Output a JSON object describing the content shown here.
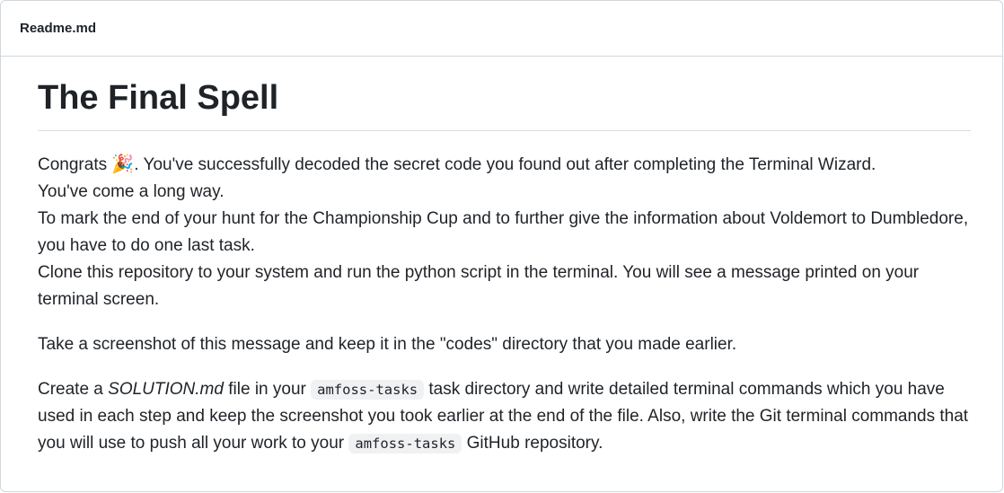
{
  "readme": {
    "filename": "Readme.md"
  },
  "content": {
    "title": "The Final Spell",
    "intro": {
      "congrats_word": "Congrats",
      "party_emoji": "🎉",
      "line1_rest": ". You've successfully decoded the secret code you found out after completing the Terminal Wizard.",
      "line2": "You've come a long way.",
      "line3": "To mark the end of your hunt for the Championship Cup and to further give the information about Voldemort to Dumbledore, you have to do one last task.",
      "line4": "Clone this repository to your system and run the python script in the terminal. You will see a message printed on your terminal screen."
    },
    "screenshot_instruction": "Take a screenshot of this message and keep it in the \"codes\" directory that you made earlier.",
    "solution": {
      "part1": "Create a ",
      "solution_file": "SOLUTION.md",
      "part2": " file in your ",
      "code1": "amfoss-tasks",
      "part3": " task directory and write detailed terminal commands which you have used in each step and keep the screenshot you took earlier at the end of the file. Also, write the Git terminal commands that you will use to push all your work to your ",
      "code2": "amfoss-tasks",
      "part4": " GitHub repository."
    }
  },
  "colors": {
    "text": "#1f2328",
    "border": "#d0d7de",
    "code_background": "#eff1f3"
  }
}
